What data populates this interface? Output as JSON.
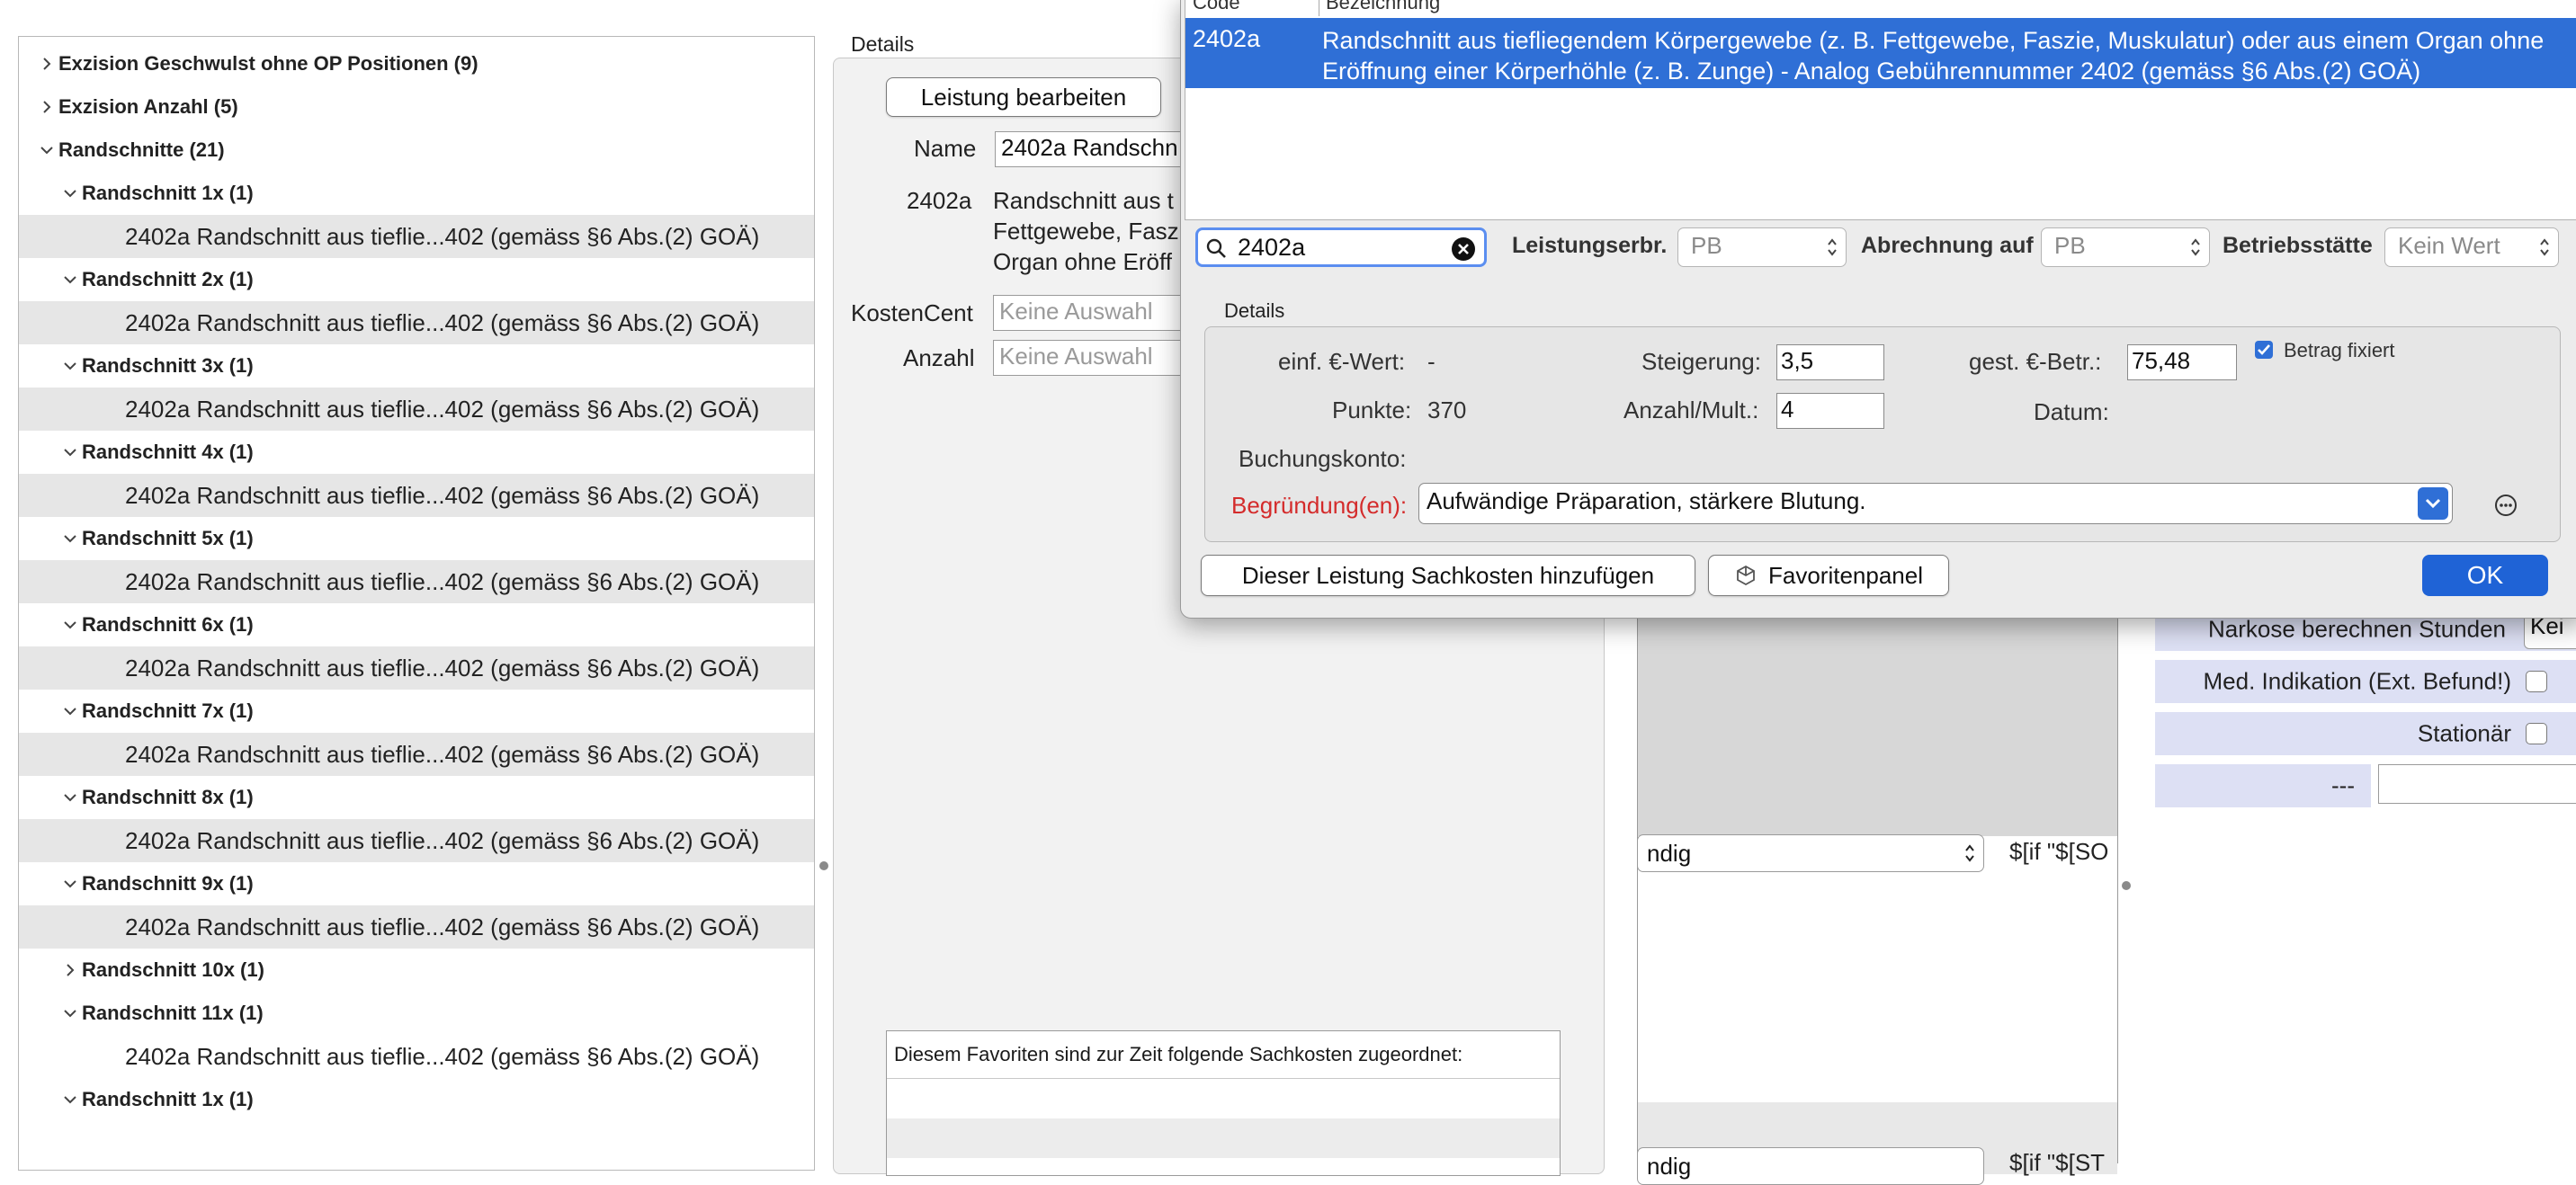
{
  "tree": {
    "rows": [
      {
        "label": "Exzision Geschwulst ohne OP Positionen (9)",
        "level": 0,
        "kind": "group",
        "expanded": false
      },
      {
        "label": "Exzision Anzahl (5)",
        "level": 0,
        "kind": "group",
        "expanded": false
      },
      {
        "label": "Randschnitte (21)",
        "level": 0,
        "kind": "group",
        "expanded": true
      },
      {
        "label": "Randschnitt 1x (1)",
        "level": 1,
        "kind": "group",
        "expanded": true
      },
      {
        "label": "2402a Randschnitt aus tieflie...402 (gemäss §6 Abs.(2) GOÄ)",
        "level": 2,
        "kind": "leaf"
      },
      {
        "label": "Randschnitt 2x (1)",
        "level": 1,
        "kind": "group",
        "expanded": true
      },
      {
        "label": "2402a Randschnitt aus tieflie...402 (gemäss §6 Abs.(2) GOÄ)",
        "level": 2,
        "kind": "leaf"
      },
      {
        "label": "Randschnitt 3x (1)",
        "level": 1,
        "kind": "group",
        "expanded": true
      },
      {
        "label": "2402a Randschnitt aus tieflie...402 (gemäss §6 Abs.(2) GOÄ)",
        "level": 2,
        "kind": "leaf"
      },
      {
        "label": "Randschnitt 4x (1)",
        "level": 1,
        "kind": "group",
        "expanded": true
      },
      {
        "label": "2402a Randschnitt aus tieflie...402 (gemäss §6 Abs.(2) GOÄ)",
        "level": 2,
        "kind": "leaf"
      },
      {
        "label": "Randschnitt 5x (1)",
        "level": 1,
        "kind": "group",
        "expanded": true
      },
      {
        "label": "2402a Randschnitt aus tieflie...402 (gemäss §6 Abs.(2) GOÄ)",
        "level": 2,
        "kind": "leaf"
      },
      {
        "label": "Randschnitt 6x (1)",
        "level": 1,
        "kind": "group",
        "expanded": true
      },
      {
        "label": "2402a Randschnitt aus tieflie...402 (gemäss §6 Abs.(2) GOÄ)",
        "level": 2,
        "kind": "leaf"
      },
      {
        "label": "Randschnitt 7x (1)",
        "level": 1,
        "kind": "group",
        "expanded": true
      },
      {
        "label": "2402a Randschnitt aus tieflie...402 (gemäss §6 Abs.(2) GOÄ)",
        "level": 2,
        "kind": "leaf"
      },
      {
        "label": "Randschnitt 8x (1)",
        "level": 1,
        "kind": "group",
        "expanded": true
      },
      {
        "label": "2402a Randschnitt aus tieflie...402 (gemäss §6 Abs.(2) GOÄ)",
        "level": 2,
        "kind": "leaf"
      },
      {
        "label": "Randschnitt 9x (1)",
        "level": 1,
        "kind": "group",
        "expanded": true
      },
      {
        "label": "2402a Randschnitt aus tieflie...402 (gemäss §6 Abs.(2) GOÄ)",
        "level": 2,
        "kind": "leaf"
      },
      {
        "label": "Randschnitt 10x (1)",
        "level": 1,
        "kind": "group",
        "expanded": false
      },
      {
        "label": "Randschnitt 11x (1)",
        "level": 1,
        "kind": "group",
        "expanded": true
      },
      {
        "label": "2402a Randschnitt aus tieflie...402 (gemäss §6 Abs.(2) GOÄ)",
        "level": 2,
        "kind": "leaf"
      },
      {
        "label": "Randschnitt 1x (1)",
        "level": 1,
        "kind": "group",
        "expanded": true
      }
    ]
  },
  "details": {
    "title": "Details",
    "edit_button": "Leistung bearbeiten",
    "name_label": "Name",
    "name_value": "2402a Randschn",
    "code": "2402a",
    "desc_lines": [
      "Randschnitt aus t",
      "Fettgewebe, Fasz",
      "Organ ohne Eröff"
    ],
    "kostencent_label": "KostenCent",
    "kostencent_placeholder": "Keine Auswahl",
    "anzahl_label": "Anzahl",
    "anzahl_placeholder": "Keine Auswahl",
    "sachkosten_header": "Diesem Favoriten sind zur Zeit folgende Sachkosten zugeordnet:"
  },
  "right_panel": {
    "select1_value": "ndig",
    "select1_expr": "$[if \"$[SO",
    "select2_value": "ndig",
    "select2_expr": "$[if \"$[ST",
    "props": [
      {
        "label": "Narkose berechnen Stunden",
        "kind": "field",
        "value": "Kei"
      },
      {
        "label": "Med. Indikation (Ext. Befund!)",
        "kind": "checkbox",
        "checked": false
      },
      {
        "label": "Stationär",
        "kind": "checkbox",
        "checked": false
      },
      {
        "label": "---",
        "kind": "text",
        "value": ""
      }
    ]
  },
  "dialog": {
    "col_code": "Code",
    "col_desc": "Bezeichnung",
    "selected_code": "2402a",
    "selected_desc": "Randschnitt aus tiefliegendem Körpergewebe (z. B. Fettgewebe, Faszie, Muskulatur) oder aus einem Organ ohne Eröffnung einer Körperhöhle (z. B. Zunge) - Analog Gebührennummer 2402 (gemäss §6 Abs.(2) GOÄ)",
    "search_value": "2402a",
    "leistungserbr_label": "Leistungserbr.",
    "leistungserbr_value": "PB",
    "abrechnung_label": "Abrechnung auf",
    "abrechnung_value": "PB",
    "betriebsstaette_label": "Betriebsstätte",
    "betriebsstaette_value": "Kein Wert",
    "inner_title": "Details",
    "einf_label": "einf. €-Wert:",
    "einf_value": "-",
    "steigerung_label": "Steigerung:",
    "steigerung_value": "3,5",
    "gest_label": "gest. €-Betr.:",
    "gest_value": "75,48",
    "betrag_fix_label": "Betrag fixiert",
    "punkte_label": "Punkte:",
    "punkte_value": "370",
    "anzahl_label": "Anzahl/Mult.:",
    "anzahl_value": "4",
    "datum_label": "Datum:",
    "buchungskonto_label": "Buchungskonto:",
    "begruendung_label": "Begründung(en):",
    "begruendung_value": "Aufwändige Präparation, stärkere Blutung.",
    "btn_sachkosten": "Dieser Leistung Sachkosten hinzufügen",
    "btn_favoriten": "Favoritenpanel",
    "btn_ok": "OK",
    "colors": {
      "accent": "#2f6fd6",
      "required_label": "#d42b2b",
      "selection": "#2f6fd6"
    }
  }
}
